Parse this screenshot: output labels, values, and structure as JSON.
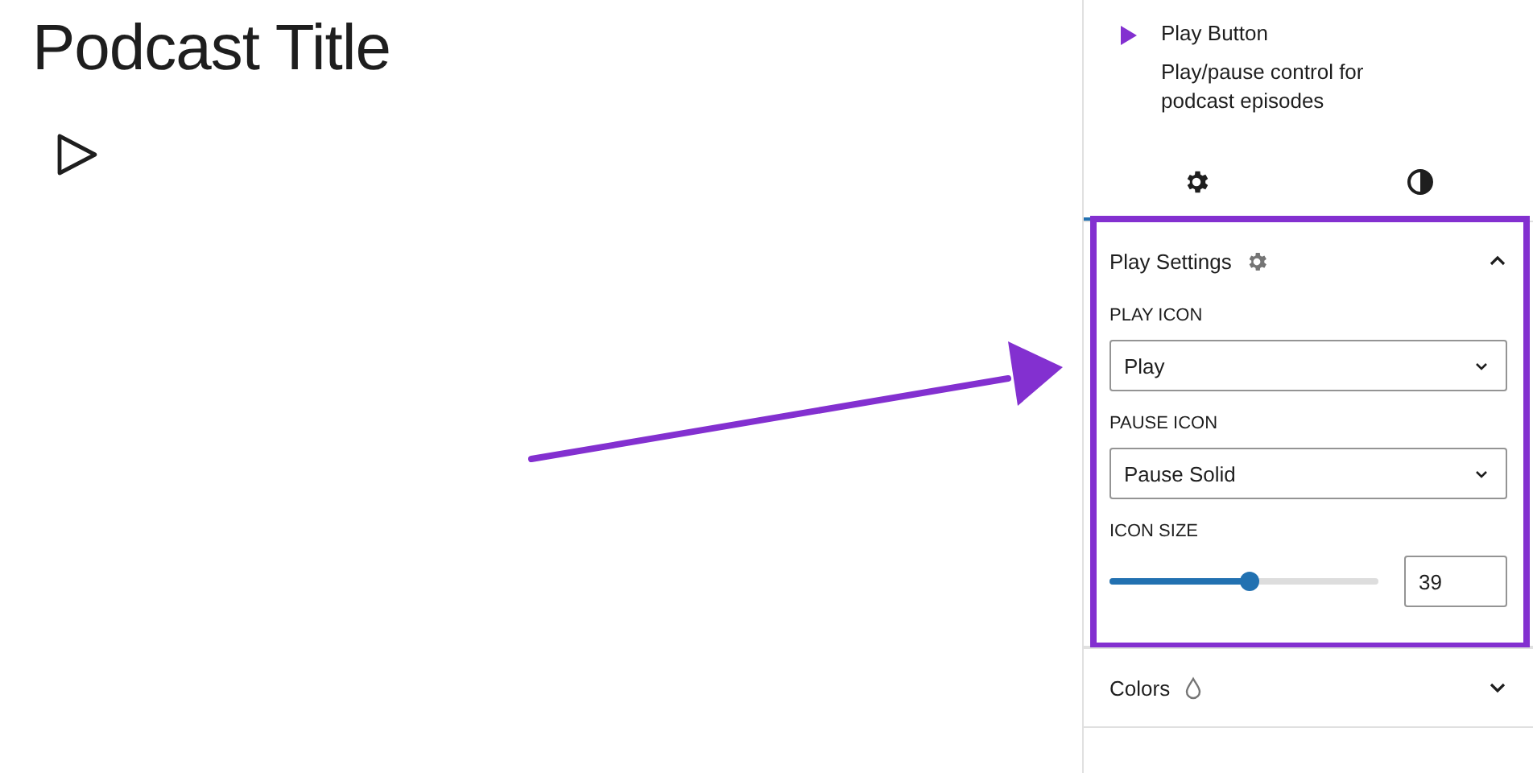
{
  "editor": {
    "title": "Podcast Title"
  },
  "block": {
    "name": "Play Button",
    "description": "Play/pause control for podcast episodes"
  },
  "tabs": [
    {
      "kind": "settings",
      "selected": true
    },
    {
      "kind": "styles",
      "selected": false
    }
  ],
  "panels": [
    {
      "kind": "settings",
      "title": "Play Settings",
      "expanded": true,
      "highlighted": true
    },
    {
      "kind": "colors",
      "title": "Colors",
      "expanded": false,
      "highlighted": false
    }
  ],
  "fields": [
    {
      "kind": "select",
      "label": "PLAY ICON",
      "value": "Play"
    },
    {
      "kind": "select",
      "label": "PAUSE ICON",
      "value": "Pause Solid"
    },
    {
      "kind": "range",
      "label": "ICON SIZE",
      "level": 0.52,
      "value": "39"
    }
  ]
}
